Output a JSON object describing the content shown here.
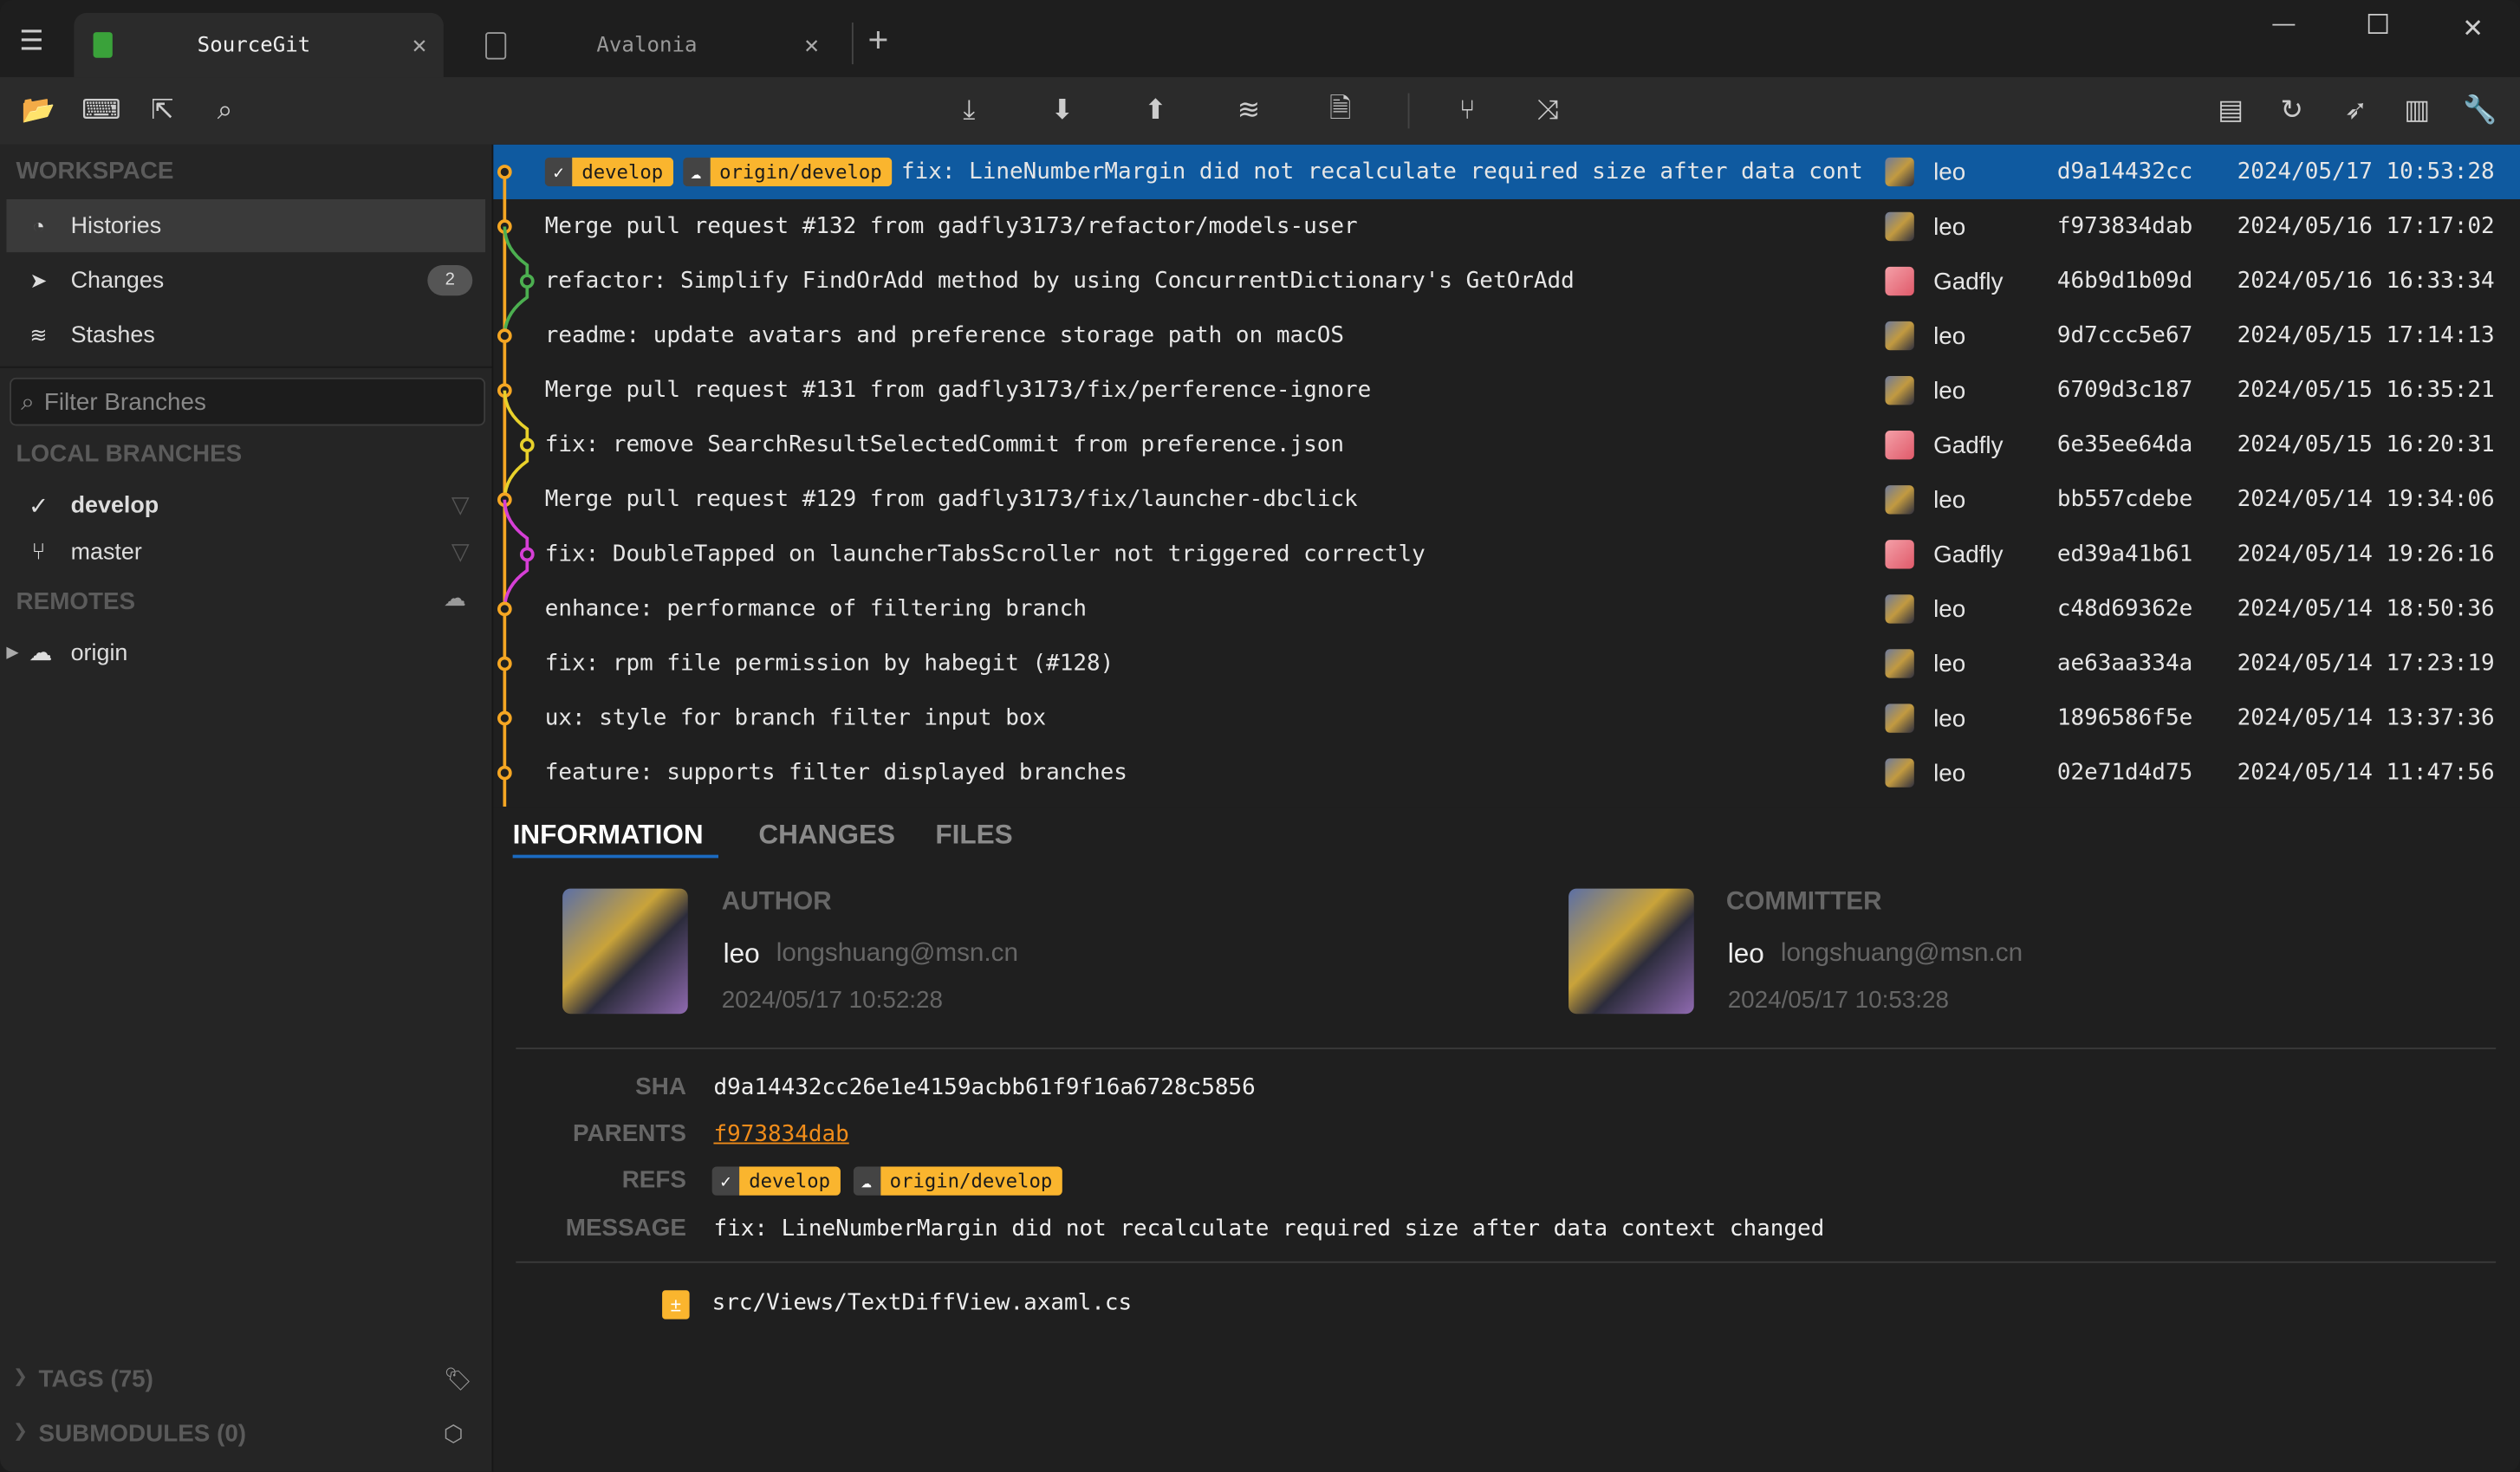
{
  "tabs": [
    {
      "label": "SourceGit",
      "close": "✕"
    },
    {
      "label": "Avalonia",
      "close": "✕"
    }
  ],
  "new_tab": "+",
  "window": {
    "minimize": "—",
    "maximize": "☐",
    "close": "✕"
  },
  "sidebar": {
    "workspace": "WORKSPACE",
    "items": [
      {
        "label": "Histories",
        "icon": "clock-icon"
      },
      {
        "label": "Changes",
        "badge": "2",
        "icon": "send-icon"
      },
      {
        "label": "Stashes",
        "icon": "layers-icon"
      }
    ],
    "filter_placeholder": "Filter Branches",
    "local_branches": "LOCAL BRANCHES",
    "branches": [
      {
        "name": "develop",
        "current": true
      },
      {
        "name": "master",
        "current": false
      }
    ],
    "remotes": "REMOTES",
    "remote_items": [
      {
        "name": "origin"
      }
    ],
    "tags": "TAGS (75)",
    "submodules": "SUBMODULES (0)"
  },
  "colors": {
    "accent": "#0f5aa0",
    "badge": "#fab52e",
    "lane_main": "#f5a623",
    "lane_green": "#4caf50",
    "lane_yellow": "#e8d12b",
    "lane_magenta": "#d63fd6",
    "link": "#f08c1a"
  },
  "commits": [
    {
      "refs": [
        {
          "icon": "✓",
          "name": "develop"
        },
        {
          "icon": "☁",
          "name": "origin/develop"
        }
      ],
      "message": "fix: LineNumberMargin did not recalculate required size after data cont",
      "author": "leo",
      "sha": "d9a14432cc",
      "date": "2024/05/17 10:53:28",
      "lane": 0
    },
    {
      "message": "Merge pull request #132 from gadfly3173/refactor/models-user",
      "author": "leo",
      "sha": "f973834dab",
      "date": "2024/05/16 17:17:02",
      "lane": 0
    },
    {
      "message": "refactor: Simplify FindOrAdd method by using ConcurrentDictionary's GetOrAdd",
      "author": "Gadfly",
      "sha": "46b9d1b09d",
      "date": "2024/05/16 16:33:34",
      "lane": 1,
      "color": "#4caf50"
    },
    {
      "message": "readme: update avatars and preference storage path on macOS",
      "author": "leo",
      "sha": "9d7ccc5e67",
      "date": "2024/05/15 17:14:13",
      "lane": 0
    },
    {
      "message": "Merge pull request #131 from gadfly3173/fix/perference-ignore",
      "author": "leo",
      "sha": "6709d3c187",
      "date": "2024/05/15 16:35:21",
      "lane": 0
    },
    {
      "message": "fix: remove SearchResultSelectedCommit from preference.json",
      "author": "Gadfly",
      "sha": "6e35ee64da",
      "date": "2024/05/15 16:20:31",
      "lane": 1,
      "color": "#e8d12b"
    },
    {
      "message": "Merge pull request #129 from gadfly3173/fix/launcher-dbclick",
      "author": "leo",
      "sha": "bb557cdebe",
      "date": "2024/05/14 19:34:06",
      "lane": 0
    },
    {
      "message": "fix: DoubleTapped on launcherTabsScroller not triggered correctly",
      "author": "Gadfly",
      "sha": "ed39a41b61",
      "date": "2024/05/14 19:26:16",
      "lane": 1,
      "color": "#d63fd6"
    },
    {
      "message": "enhance: performance of filtering branch",
      "author": "leo",
      "sha": "c48d69362e",
      "date": "2024/05/14 18:50:36",
      "lane": 0
    },
    {
      "message": "fix: rpm file permission by habegit (#128)",
      "author": "leo",
      "sha": "ae63aa334a",
      "date": "2024/05/14 17:23:19",
      "lane": 0
    },
    {
      "message": "ux: style for branch filter input box",
      "author": "leo",
      "sha": "1896586f5e",
      "date": "2024/05/14 13:37:36",
      "lane": 0
    },
    {
      "message": "feature: supports filter displayed branches",
      "author": "leo",
      "sha": "02e71d4d75",
      "date": "2024/05/14 11:47:56",
      "lane": 0
    }
  ],
  "detail": {
    "tabs": [
      "INFORMATION",
      "CHANGES",
      "FILES"
    ],
    "author_label": "AUTHOR",
    "author": "leo",
    "author_email": "longshuang@msn.cn",
    "author_date": "2024/05/17 10:52:28",
    "committer_label": "COMMITTER",
    "committer": "leo",
    "committer_email": "longshuang@msn.cn",
    "committer_date": "2024/05/17 10:53:28",
    "sha_label": "SHA",
    "sha": "d9a14432cc26e1e4159acbb61f9f16a6728c5856",
    "parents_label": "PARENTS",
    "parent": "f973834dab",
    "refs_label": "REFS",
    "refs": [
      {
        "icon": "✓",
        "name": "develop"
      },
      {
        "icon": "☁",
        "name": "origin/develop"
      }
    ],
    "message_label": "MESSAGE",
    "message": "fix: LineNumberMargin did not recalculate required size after data context changed",
    "file_status": "±",
    "file": "src/Views/TextDiffView.axaml.cs"
  }
}
